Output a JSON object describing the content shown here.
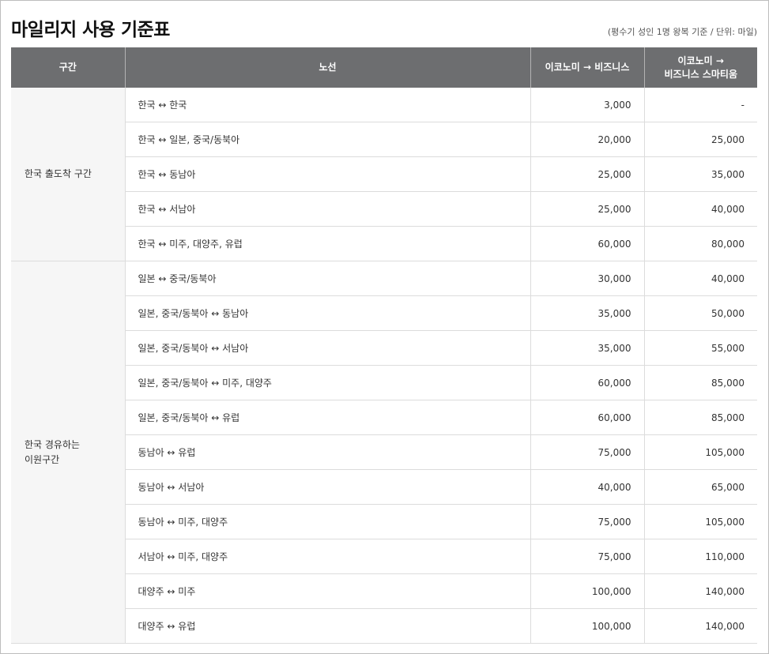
{
  "page": {
    "title": "마일리지 사용 기준표",
    "note": "(평수기 성인 1명 왕복 기준 / 단위: 마일)"
  },
  "table": {
    "headers": [
      "구간",
      "노선",
      "이코노미 → 비즈니스",
      "이코노미 →\n비즈니스 스마티움"
    ],
    "groups": [
      {
        "segment": "한국 출도착 구간",
        "rows": [
          {
            "route": "한국 ↔ 한국",
            "business": "3,000",
            "smartium": "-"
          },
          {
            "route": "한국 ↔ 일본, 중국/동북아",
            "business": "20,000",
            "smartium": "25,000"
          },
          {
            "route": "한국 ↔ 동남아",
            "business": "25,000",
            "smartium": "35,000"
          },
          {
            "route": "한국 ↔ 서남아",
            "business": "25,000",
            "smartium": "40,000"
          },
          {
            "route": "한국 ↔ 미주, 대양주, 유럽",
            "business": "60,000",
            "smartium": "80,000"
          }
        ]
      },
      {
        "segment": "한국 경유하는\n이원구간",
        "rows": [
          {
            "route": "일본 ↔ 중국/동북아",
            "business": "30,000",
            "smartium": "40,000"
          },
          {
            "route": "일본, 중국/동북아 ↔ 동남아",
            "business": "35,000",
            "smartium": "50,000"
          },
          {
            "route": "일본, 중국/동북아 ↔ 서남아",
            "business": "35,000",
            "smartium": "55,000"
          },
          {
            "route": "일본, 중국/동북아 ↔ 미주, 대양주",
            "business": "60,000",
            "smartium": "85,000"
          },
          {
            "route": "일본, 중국/동북아 ↔ 유럽",
            "business": "60,000",
            "smartium": "85,000"
          },
          {
            "route": "동남아 ↔ 유럽",
            "business": "75,000",
            "smartium": "105,000"
          },
          {
            "route": "동남아 ↔ 서남아",
            "business": "40,000",
            "smartium": "65,000"
          },
          {
            "route": "동남아 ↔ 미주, 대양주",
            "business": "75,000",
            "smartium": "105,000"
          },
          {
            "route": "서남아 ↔ 미주, 대양주",
            "business": "75,000",
            "smartium": "110,000"
          },
          {
            "route": "대양주 ↔ 미주",
            "business": "100,000",
            "smartium": "140,000"
          },
          {
            "route": "대양주 ↔ 유럽",
            "business": "100,000",
            "smartium": "140,000"
          }
        ]
      }
    ]
  }
}
